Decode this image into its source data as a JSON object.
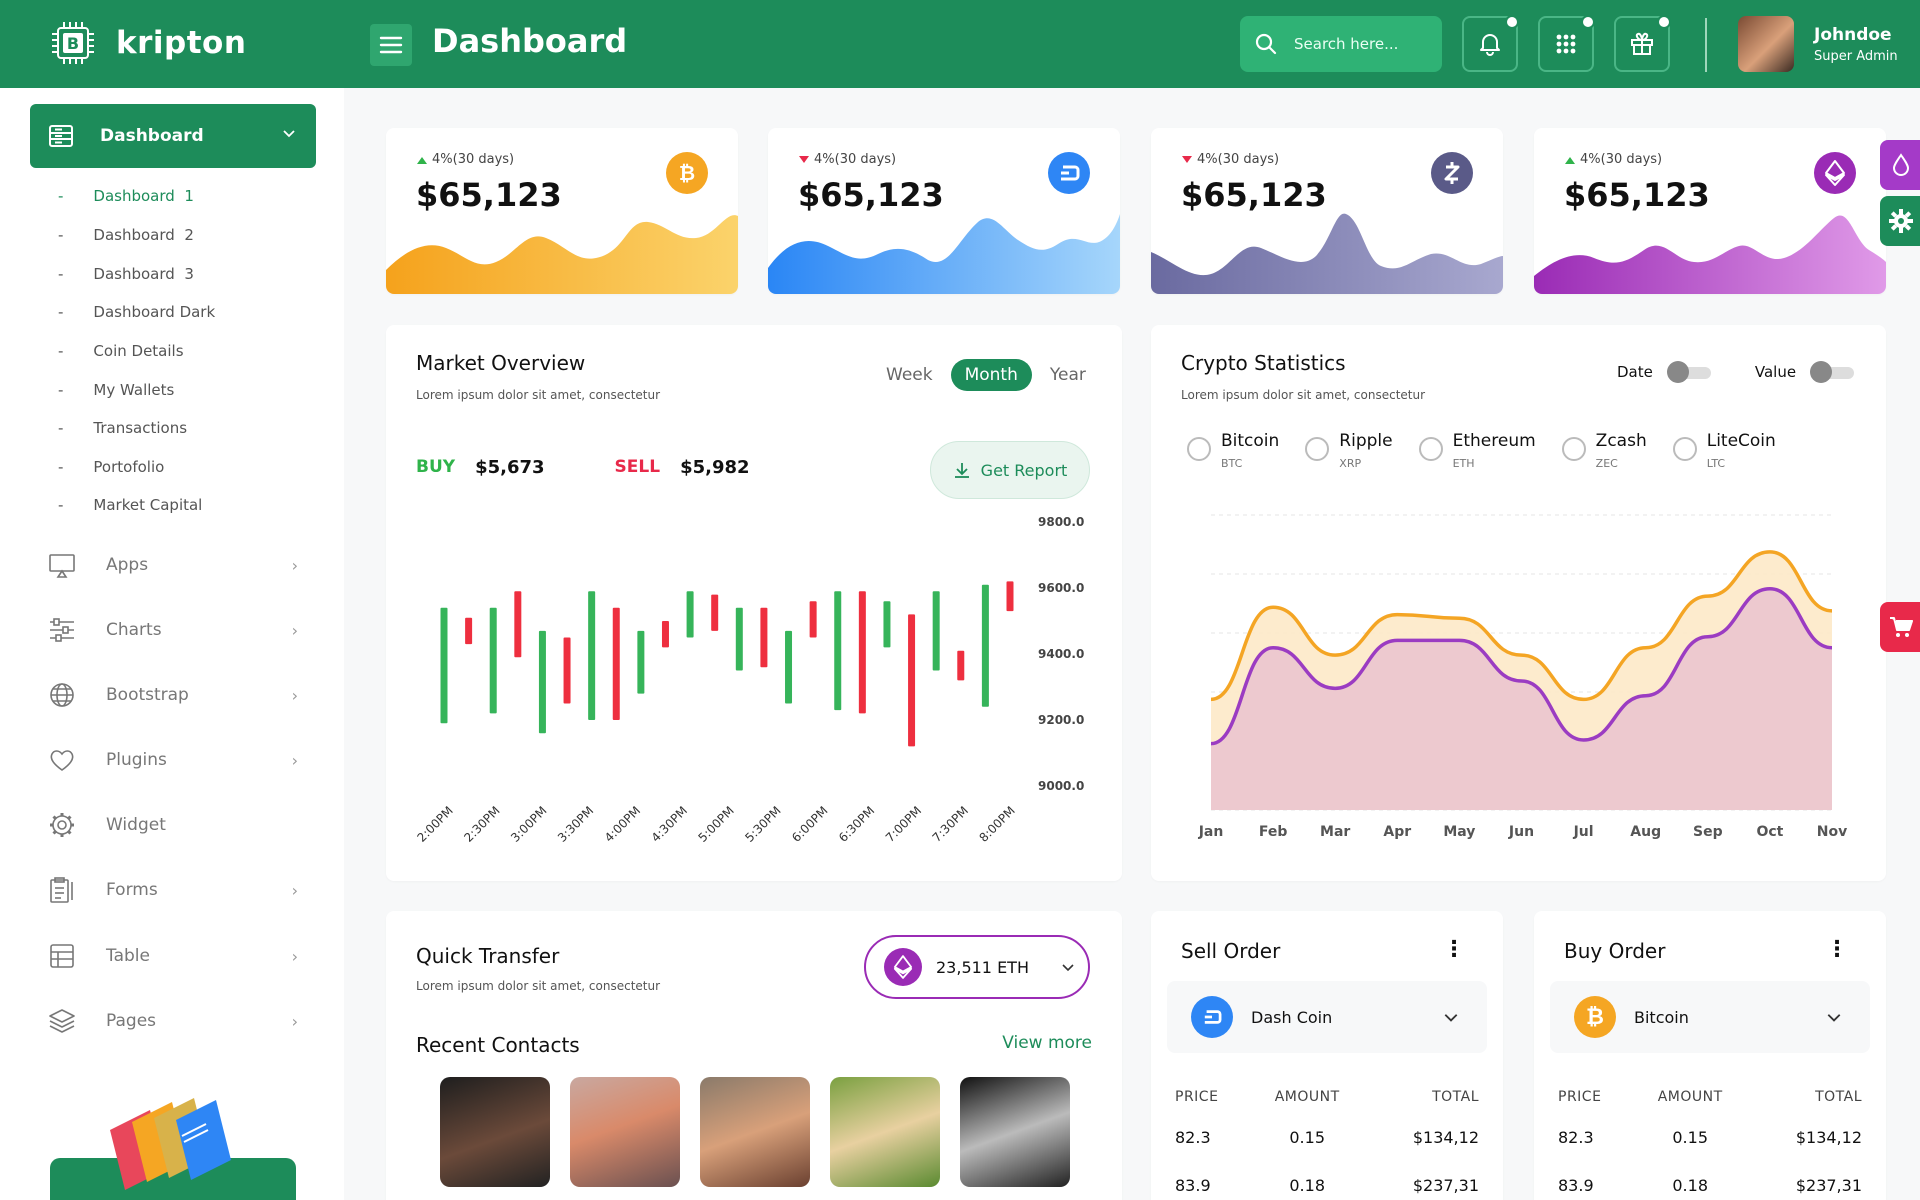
{
  "app": {
    "name": "kripton",
    "page_title": "Dashboard"
  },
  "header": {
    "search_placeholder": "Search here...",
    "user": {
      "name": "Johndoe",
      "role": "Super Admin"
    }
  },
  "sidebar": {
    "main": {
      "label": "Dashboard"
    },
    "submenu": [
      {
        "label": "Dashboard",
        "num": "1"
      },
      {
        "label": "Dashboard",
        "num": "2"
      },
      {
        "label": "Dashboard",
        "num": "3"
      },
      {
        "label": "Dashboard Dark",
        "num": ""
      },
      {
        "label": "Coin Details",
        "num": ""
      },
      {
        "label": "My Wallets",
        "num": ""
      },
      {
        "label": "Transactions",
        "num": ""
      },
      {
        "label": "Portofolio",
        "num": ""
      },
      {
        "label": "Market Capital",
        "num": ""
      }
    ],
    "items": [
      {
        "label": "Apps"
      },
      {
        "label": "Charts"
      },
      {
        "label": "Bootstrap"
      },
      {
        "label": "Plugins"
      },
      {
        "label": "Widget"
      },
      {
        "label": "Forms"
      },
      {
        "label": "Table"
      },
      {
        "label": "Pages"
      }
    ]
  },
  "stats": [
    {
      "change": "4%(30 days)",
      "trend": "up",
      "value": "$65,123",
      "coin": "bitcoin",
      "color": "#f5a623"
    },
    {
      "change": "4%(30 days)",
      "trend": "down",
      "value": "$65,123",
      "coin": "dash",
      "color": "#2e86f5"
    },
    {
      "change": "4%(30 days)",
      "trend": "down",
      "value": "$65,123",
      "coin": "zcash",
      "color": "#5a5a88"
    },
    {
      "change": "4%(30 days)",
      "trend": "up",
      "value": "$65,123",
      "coin": "ethereum",
      "color": "#9a2bb5"
    }
  ],
  "market": {
    "title": "Market Overview",
    "subtitle": "Lorem ipsum dolor sit amet, consectetur",
    "tabs": [
      "Week",
      "Month",
      "Year"
    ],
    "active_tab": "Month",
    "buy_label": "BUY",
    "buy_value": "$5,673",
    "sell_label": "SELL",
    "sell_value": "$5,982",
    "report_label": "Get Report"
  },
  "crypto": {
    "title": "Crypto Statistics",
    "subtitle": "Lorem ipsum dolor sit amet, consectetur",
    "toggles": [
      "Date",
      "Value"
    ],
    "coins": [
      {
        "name": "Bitcoin",
        "sym": "BTC"
      },
      {
        "name": "Ripple",
        "sym": "XRP"
      },
      {
        "name": "Ethereum",
        "sym": "ETH"
      },
      {
        "name": "Zcash",
        "sym": "ZEC"
      },
      {
        "name": "LiteCoin",
        "sym": "LTC"
      }
    ]
  },
  "transfer": {
    "title": "Quick Transfer",
    "subtitle": "Lorem ipsum dolor sit amet, consectetur",
    "amount": "23,511 ETH",
    "contacts_title": "Recent Contacts",
    "view_more": "View more"
  },
  "sell_order": {
    "title": "Sell Order",
    "coin": "Dash Coin",
    "headers": [
      "PRICE",
      "AMOUNT",
      "TOTAL"
    ],
    "rows": [
      [
        "82.3",
        "0.15",
        "$134,12"
      ],
      [
        "83.9",
        "0.18",
        "$237,31"
      ]
    ]
  },
  "buy_order": {
    "title": "Buy Order",
    "coin": "Bitcoin",
    "headers": [
      "PRICE",
      "AMOUNT",
      "TOTAL"
    ],
    "rows": [
      [
        "82.3",
        "0.15",
        "$134,12"
      ],
      [
        "83.9",
        "0.18",
        "$237,31"
      ]
    ]
  },
  "chart_data": [
    {
      "type": "candlestick",
      "x": [
        "2:00PM",
        "2:30PM",
        "3:00PM",
        "3:30PM",
        "4:00PM",
        "4:30PM",
        "5:00PM",
        "5:30PM",
        "6:00PM",
        "6:30PM",
        "7:00PM",
        "7:30PM",
        "8:00PM"
      ],
      "y_ticks": [
        9800.0,
        9600.0,
        9400.0,
        9200.0,
        9000.0
      ],
      "ylim": [
        9000,
        9800
      ],
      "candles": [
        {
          "low": 9190,
          "high": 9540,
          "up": true
        },
        {
          "low": 9430,
          "high": 9510,
          "up": false
        },
        {
          "low": 9220,
          "high": 9540,
          "up": true
        },
        {
          "low": 9390,
          "high": 9590,
          "up": false
        },
        {
          "low": 9160,
          "high": 9470,
          "up": true
        },
        {
          "low": 9250,
          "high": 9450,
          "up": false
        },
        {
          "low": 9200,
          "high": 9590,
          "up": true
        },
        {
          "low": 9200,
          "high": 9540,
          "up": false
        },
        {
          "low": 9280,
          "high": 9470,
          "up": true
        },
        {
          "low": 9420,
          "high": 9500,
          "up": false
        },
        {
          "low": 9450,
          "high": 9590,
          "up": true
        },
        {
          "low": 9470,
          "high": 9580,
          "up": false
        },
        {
          "low": 9350,
          "high": 9540,
          "up": true
        },
        {
          "low": 9360,
          "high": 9540,
          "up": false
        },
        {
          "low": 9250,
          "high": 9470,
          "up": true
        },
        {
          "low": 9450,
          "high": 9560,
          "up": false
        },
        {
          "low": 9230,
          "high": 9590,
          "up": true
        },
        {
          "low": 9220,
          "high": 9590,
          "up": false
        },
        {
          "low": 9420,
          "high": 9560,
          "up": true
        },
        {
          "low": 9120,
          "high": 9520,
          "up": false
        },
        {
          "low": 9350,
          "high": 9590,
          "up": true
        },
        {
          "low": 9320,
          "high": 9410,
          "up": false
        },
        {
          "low": 9240,
          "high": 9610,
          "up": true
        },
        {
          "low": 9530,
          "high": 9620,
          "up": false
        }
      ]
    },
    {
      "type": "area",
      "categories": [
        "Jan",
        "Feb",
        "Mar",
        "Apr",
        "May",
        "Jun",
        "Jul",
        "Aug",
        "Sep",
        "Oct",
        "Nov"
      ],
      "series": [
        {
          "values": [
            30,
            55,
            42,
            53,
            52,
            42,
            30,
            44,
            58,
            70,
            54
          ],
          "color": "#f4a524"
        },
        {
          "values": [
            18,
            44,
            33,
            46,
            46,
            35,
            19,
            31,
            47,
            60,
            44
          ],
          "color": "#9b3cc2"
        }
      ],
      "ylim": [
        0,
        80
      ]
    }
  ]
}
